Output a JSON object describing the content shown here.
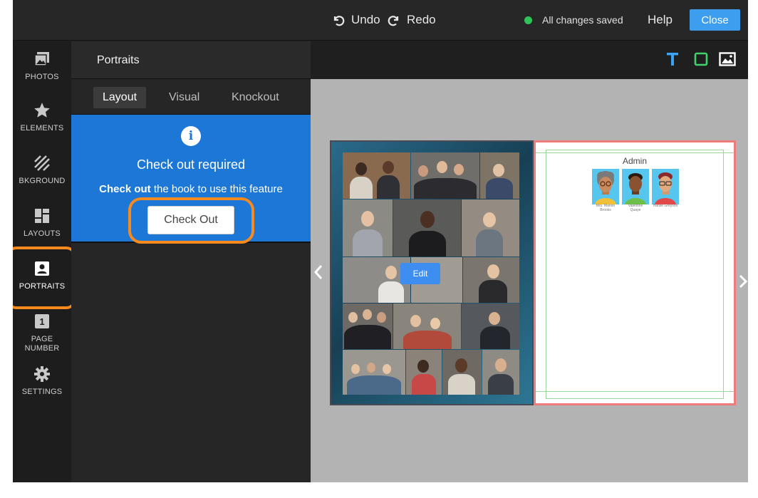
{
  "topbar": {
    "undo_label": "Undo",
    "redo_label": "Redo",
    "status_text": "All changes saved",
    "help_label": "Help",
    "close_label": "Close",
    "status_color": "#2ec45a",
    "accent_color": "#3d9ef0"
  },
  "leftnav": {
    "items": [
      {
        "label": "PHOTOS",
        "icon": "photos-icon"
      },
      {
        "label": "ELEMENTS",
        "icon": "star-icon"
      },
      {
        "label": "BKGROUND",
        "icon": "background-icon"
      },
      {
        "label": "LAYOUTS",
        "icon": "layouts-icon"
      },
      {
        "label": "PORTRAITS",
        "icon": "portrait-icon"
      },
      {
        "label": "PAGE NUMBER",
        "icon": "page-number-icon",
        "badge": "1"
      },
      {
        "label": "SETTINGS",
        "icon": "gear-icon"
      }
    ],
    "active": "PORTRAITS"
  },
  "panel": {
    "title": "Portraits",
    "tabs": [
      "Layout",
      "Visual",
      "Knockout"
    ],
    "active_tab": "Layout",
    "info": {
      "icon_text": "i",
      "title": "Check out required",
      "message_bold": "Check out",
      "message_rest": " the book to use this feature",
      "button_label": "Check Out",
      "color": "#1d77d6"
    }
  },
  "canvas": {
    "tools": [
      "text-tool-icon",
      "shape-tool-icon",
      "image-tool-icon"
    ],
    "edit_label": "Edit",
    "right_page": {
      "heading": "Admin",
      "portraits": [
        {
          "name_line1": "Mrs. Marion",
          "name_line2": "Brooks"
        },
        {
          "name_line1": "Valentine",
          "name_line2": "Quaye"
        },
        {
          "name_line1": "Hanse Greyson",
          "name_line2": ""
        }
      ]
    }
  }
}
